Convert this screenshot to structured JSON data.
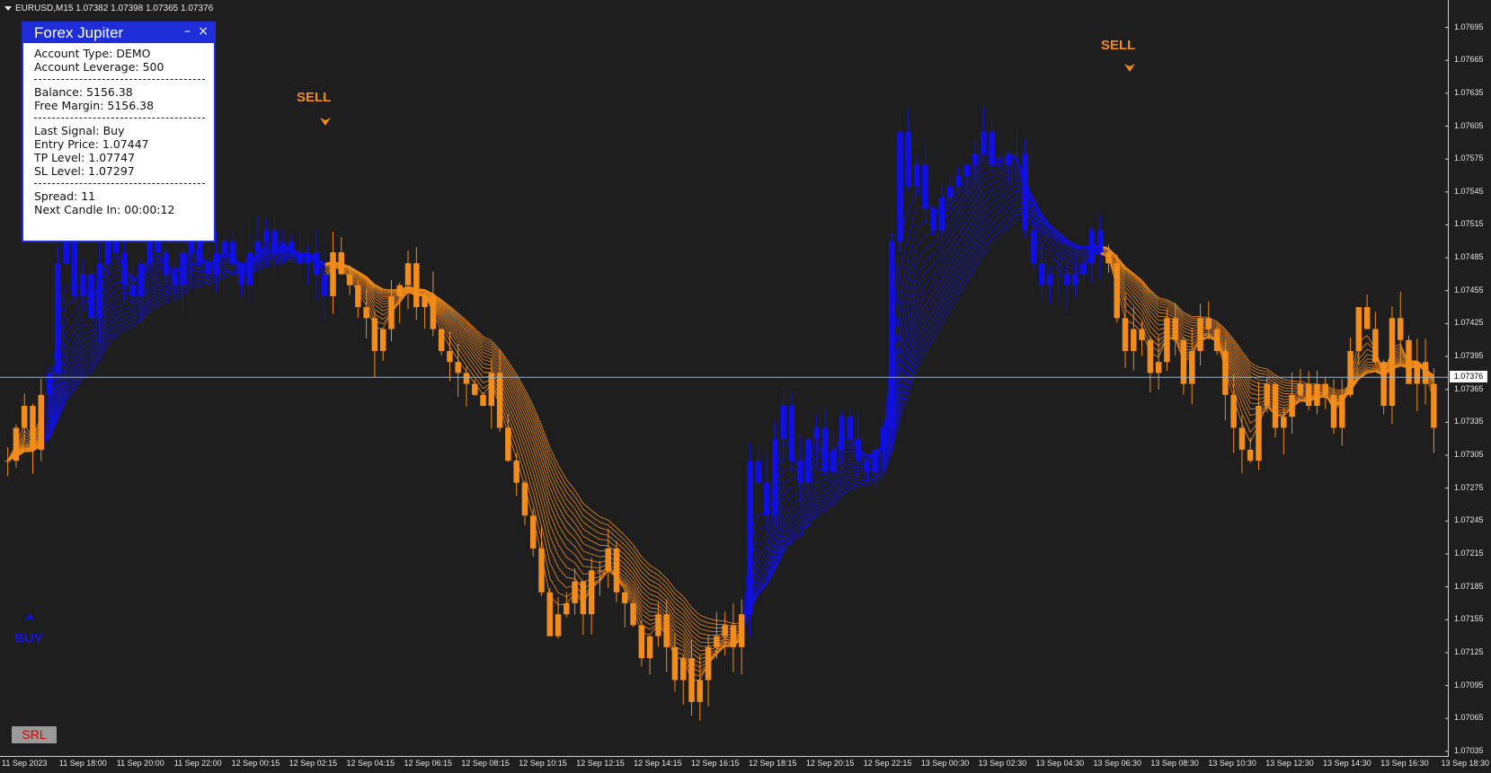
{
  "window": {
    "title": "EURUSD,M15  1.07382 1.07398 1.07365 1.07376"
  },
  "panel": {
    "title": "Forex Jupiter",
    "minimize_label": "–",
    "close_label": "×",
    "account_type": "Account Type: DEMO",
    "account_leverage": "Account Leverage: 500",
    "balance": "Balance: 5156.38",
    "free_margin": "Free Margin: 5156.38",
    "last_signal": "Last Signal: Buy",
    "entry_price": "Entry Price: 1.07447",
    "tp_level": "TP Level: 1.07747",
    "sl_level": "SL Level: 1.07297",
    "spread": "Spread: 11",
    "next_candle": "Next Candle In: 00:00:12"
  },
  "signals": [
    {
      "label": "SELL",
      "type": "sell"
    },
    {
      "label": "SELL",
      "type": "sell"
    },
    {
      "label": "BUY",
      "type": "buy"
    }
  ],
  "srl_button": "SRL",
  "current_price_label": "1.07376",
  "colors": {
    "bull": "#1010e6",
    "bear": "#f28c1a",
    "background": "#1e1e1e",
    "axis": "#e6e6e6",
    "panel_header": "#1e2dd8"
  },
  "chart_data": {
    "type": "candlestick",
    "symbol": "EURUSD",
    "timeframe": "M15",
    "ohlc_header": [
      1.07382,
      1.07398,
      1.07365,
      1.07376
    ],
    "ylim": [
      1.0703,
      1.0772
    ],
    "y_ticks": [
      "1.07695",
      "1.07665",
      "1.07635",
      "1.07605",
      "1.07575",
      "1.07545",
      "1.07515",
      "1.07485",
      "1.07455",
      "1.07425",
      "1.07395",
      "1.07365",
      "1.07335",
      "1.07305",
      "1.07275",
      "1.07245",
      "1.07215",
      "1.07185",
      "1.07155",
      "1.07125",
      "1.07095",
      "1.07065",
      "1.07035"
    ],
    "x_ticks": [
      "11 Sep 2023",
      "11 Sep 18:00",
      "11 Sep 20:00",
      "11 Sep 22:00",
      "12 Sep 00:15",
      "12 Sep 02:15",
      "12 Sep 04:15",
      "12 Sep 06:15",
      "12 Sep 08:15",
      "12 Sep 10:15",
      "12 Sep 12:15",
      "12 Sep 14:15",
      "12 Sep 16:15",
      "12 Sep 18:15",
      "12 Sep 20:15",
      "12 Sep 22:15",
      "13 Sep 00:30",
      "13 Sep 02:30",
      "13 Sep 04:30",
      "13 Sep 06:30",
      "13 Sep 08:30",
      "13 Sep 10:30",
      "13 Sep 12:30",
      "13 Sep 14:30",
      "13 Sep 16:30",
      "13 Sep 18:30"
    ],
    "current_price": 1.07376,
    "close_series": [
      {
        "name": "",
        "trend": "bear",
        "values": [
          1.073,
          1.0733,
          1.0735,
          1.0731,
          1.0736
        ]
      },
      {
        "name": "",
        "trend": "bull",
        "values": [
          1.0738,
          1.0748,
          1.075,
          1.0745,
          1.0747,
          1.0743,
          1.0748,
          1.0752,
          1.0749,
          1.0746,
          1.0745,
          1.0748,
          1.075,
          1.0749,
          1.0747,
          1.0746,
          1.0749,
          1.0751,
          1.0748,
          1.0747,
          1.0749,
          1.075,
          1.0748,
          1.0746,
          1.0749,
          1.075,
          1.0751,
          1.0749,
          1.075,
          1.0749,
          1.0748,
          1.0749,
          1.0747,
          1.0745
        ]
      },
      {
        "name": "",
        "trend": "bear",
        "values": [
          1.0749,
          1.0747,
          1.0746,
          1.0744,
          1.0743,
          1.074,
          1.0742,
          1.0745,
          1.0746,
          1.0748,
          1.0744,
          1.0745,
          1.0742,
          1.074,
          1.0739,
          1.0738,
          1.0737,
          1.0736,
          1.0735,
          1.0738,
          1.0733,
          1.073,
          1.0728,
          1.0725,
          1.0722,
          1.0718,
          1.0714,
          1.0716,
          1.0717,
          1.0719,
          1.0716,
          1.072,
          1.072,
          1.0722,
          1.0718,
          1.0717,
          1.0715,
          1.0712,
          1.0714,
          1.0716,
          1.0713,
          1.071,
          1.0712,
          1.0708,
          1.071,
          1.0713,
          1.0714,
          1.0715,
          1.0713,
          1.0716
        ]
      },
      {
        "name": "",
        "trend": "bull",
        "values": [
          1.073,
          1.0728,
          1.0725,
          1.0732,
          1.0735,
          1.073,
          1.0728,
          1.0732,
          1.0733,
          1.0729,
          1.0731,
          1.0734,
          1.0732,
          1.073,
          1.0729,
          1.0731,
          1.0733,
          1.075,
          1.076,
          1.0755,
          1.0757,
          1.0753,
          1.0751,
          1.0754,
          1.0755,
          1.0756,
          1.0757,
          1.0758,
          1.076,
          1.0757,
          1.0757,
          1.0758,
          1.0758,
          1.0751,
          1.0748,
          1.0746,
          1.0747,
          1.0747,
          1.0746,
          1.0747,
          1.0748,
          1.0751,
          1.0749
        ]
      },
      {
        "name": "",
        "trend": "bear",
        "values": [
          1.0748,
          1.0743,
          1.074,
          1.0742,
          1.0741,
          1.0738,
          1.0739,
          1.0743,
          1.0741,
          1.0737,
          1.074,
          1.0743,
          1.0742,
          1.074,
          1.0736,
          1.0733,
          1.0731,
          1.073,
          1.0735,
          1.0737,
          1.0733,
          1.0734,
          1.0736,
          1.0737,
          1.0735,
          1.0737,
          1.0736,
          1.0733,
          1.0736,
          1.074,
          1.0744,
          1.0742,
          1.0739,
          1.0735,
          1.0743,
          1.0741,
          1.0737,
          1.0739,
          1.0737,
          1.0733
        ]
      }
    ]
  }
}
